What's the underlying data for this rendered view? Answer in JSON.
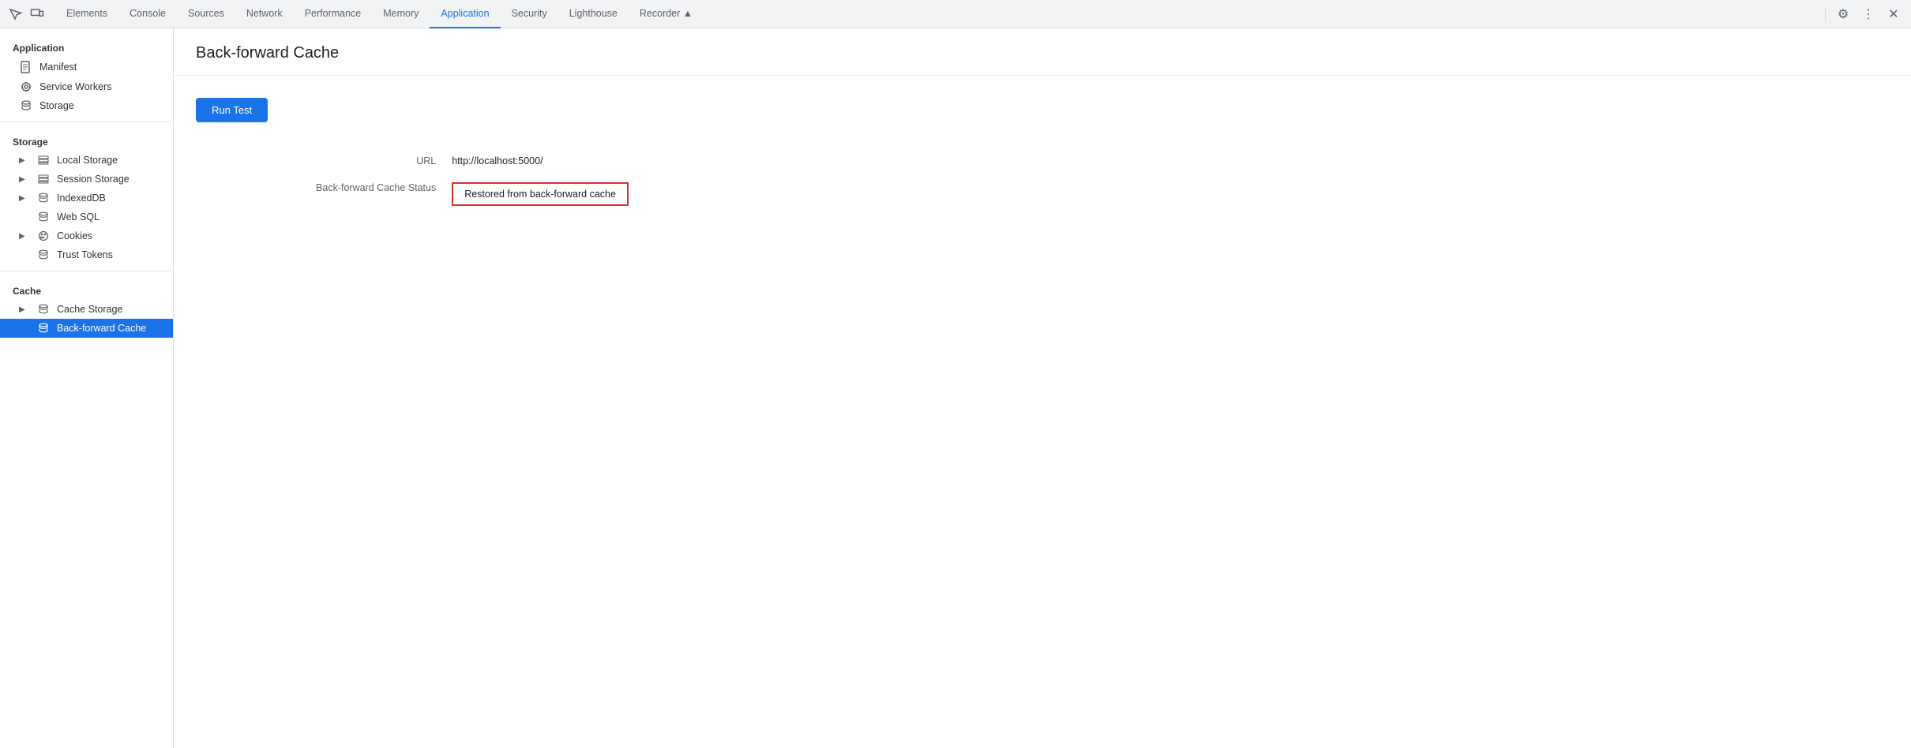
{
  "tabs": {
    "items": [
      {
        "label": "Elements",
        "active": false
      },
      {
        "label": "Console",
        "active": false
      },
      {
        "label": "Sources",
        "active": false
      },
      {
        "label": "Network",
        "active": false
      },
      {
        "label": "Performance",
        "active": false
      },
      {
        "label": "Memory",
        "active": false
      },
      {
        "label": "Application",
        "active": true
      },
      {
        "label": "Security",
        "active": false
      },
      {
        "label": "Lighthouse",
        "active": false
      },
      {
        "label": "Recorder ▲",
        "active": false
      }
    ]
  },
  "sidebar": {
    "application_title": "Application",
    "items_application": [
      {
        "label": "Manifest",
        "icon": "📄"
      },
      {
        "label": "Service Workers",
        "icon": "⚙"
      },
      {
        "label": "Storage",
        "icon": "🗄"
      }
    ],
    "storage_title": "Storage",
    "items_storage": [
      {
        "label": "Local Storage",
        "has_chevron": true
      },
      {
        "label": "Session Storage",
        "has_chevron": true
      },
      {
        "label": "IndexedDB",
        "has_chevron": true
      },
      {
        "label": "Web SQL",
        "has_chevron": false
      },
      {
        "label": "Cookies",
        "has_chevron": true
      },
      {
        "label": "Trust Tokens",
        "has_chevron": false
      }
    ],
    "cache_title": "Cache",
    "items_cache": [
      {
        "label": "Cache Storage",
        "has_chevron": true,
        "active": false
      },
      {
        "label": "Back-forward Cache",
        "has_chevron": false,
        "active": true
      }
    ]
  },
  "content": {
    "page_title": "Back-forward Cache",
    "run_test_label": "Run Test",
    "url_label": "URL",
    "url_value": "http://localhost:5000/",
    "status_label": "Back-forward Cache Status",
    "status_value": "Restored from back-forward cache"
  }
}
